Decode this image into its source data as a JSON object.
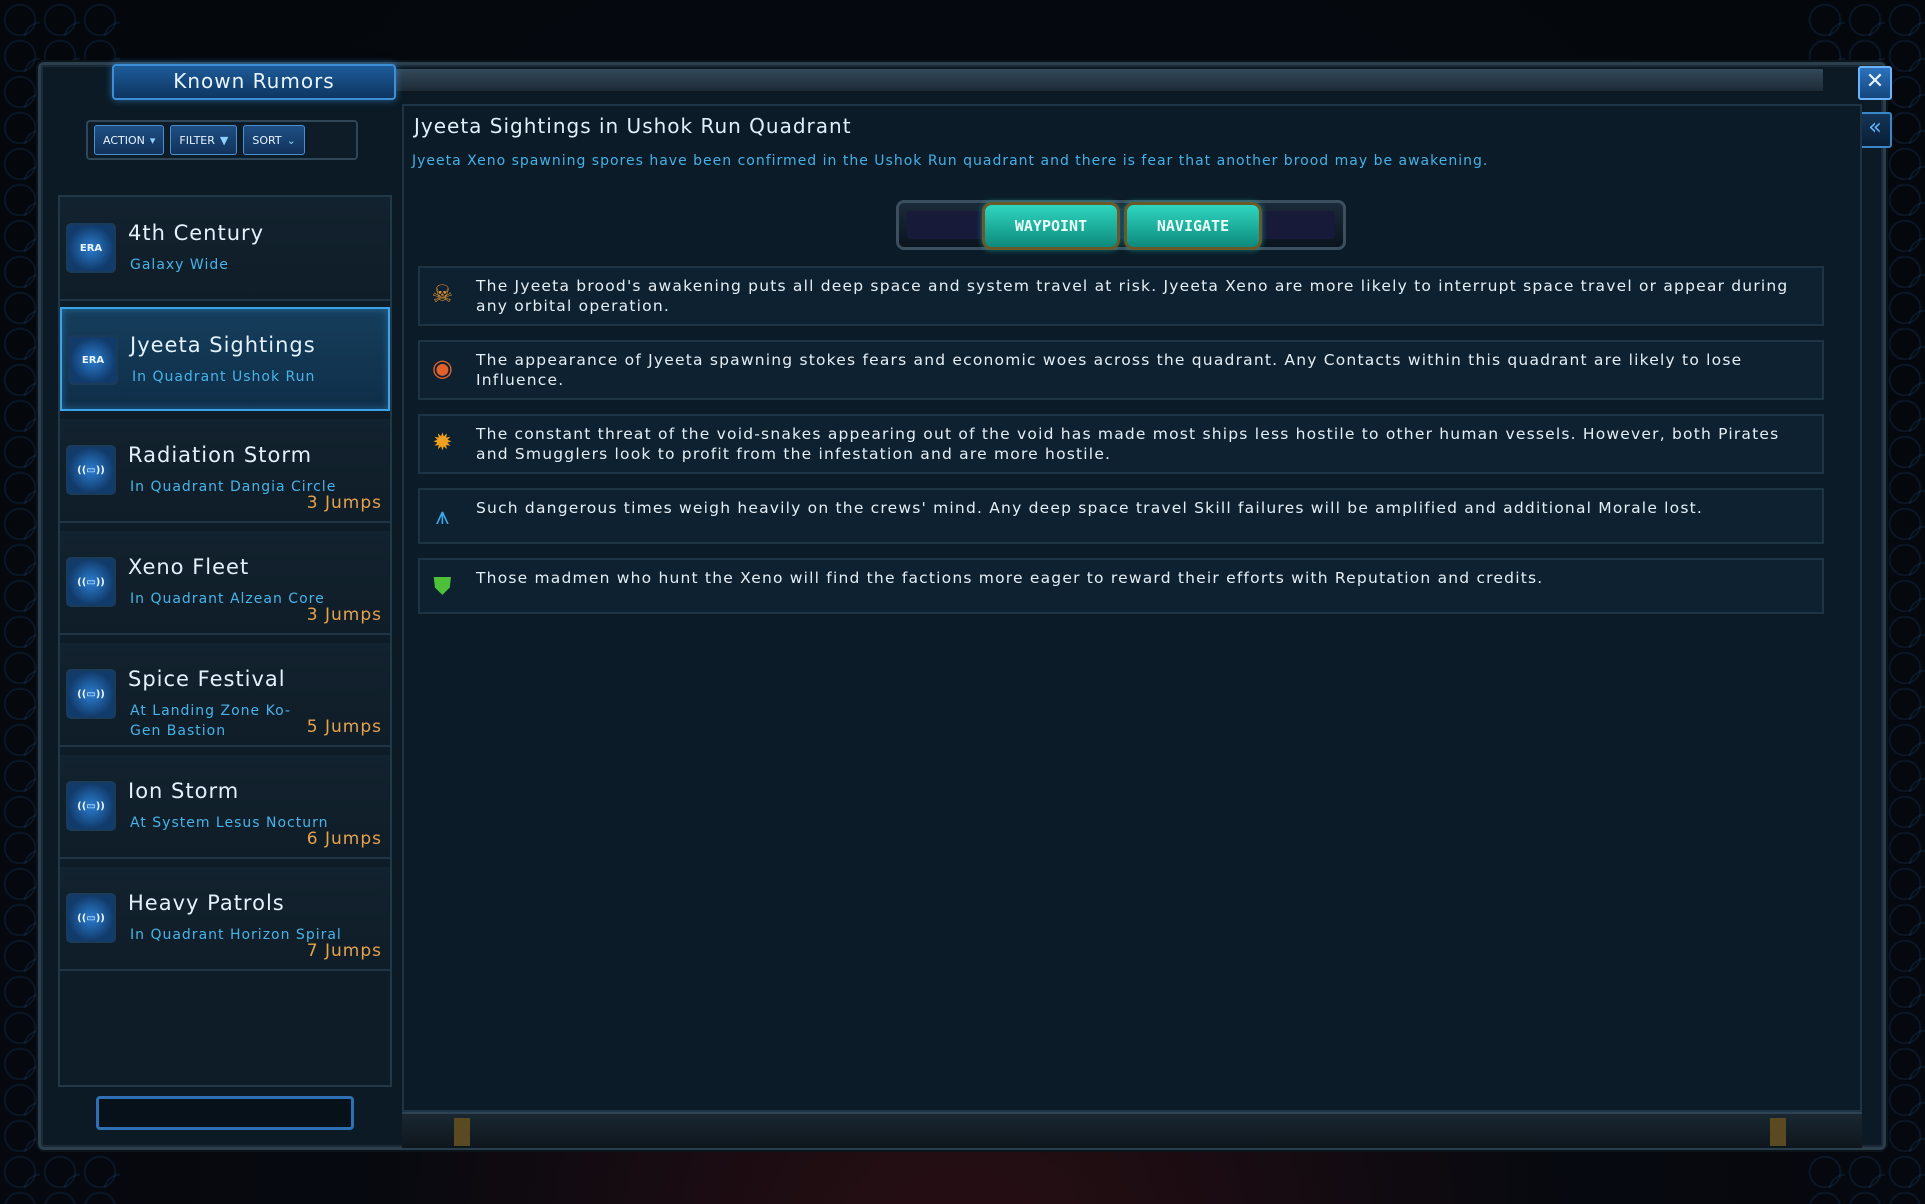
{
  "window": {
    "title": "Known Rumors"
  },
  "toolbar": {
    "action_label": "ACTION",
    "filter_label": "FILTER",
    "sort_label": "SORT"
  },
  "icons": {
    "close": "close-icon",
    "collapse": "double-chevron-left-icon"
  },
  "rumors": [
    {
      "name": "4th Century",
      "location": "Galaxy Wide",
      "jumps": "",
      "icon": "ERA"
    },
    {
      "name": "Jyeeta Sightings",
      "location": "In Quadrant Ushok Run",
      "jumps": "",
      "icon": "ERA",
      "selected": true
    },
    {
      "name": "Radiation Storm",
      "location": "In Quadrant Dangia Circle",
      "jumps": "3 Jumps",
      "icon": "rumor"
    },
    {
      "name": "Xeno Fleet",
      "location": "In Quadrant Alzean Core",
      "jumps": "3 Jumps",
      "icon": "rumor"
    },
    {
      "name": "Spice Festival",
      "location": "At Landing Zone Ko-Gen Bastion",
      "jumps": "5 Jumps",
      "icon": "rumor"
    },
    {
      "name": "Ion Storm",
      "location": "At System Lesus Nocturn",
      "jumps": "6 Jumps",
      "icon": "rumor"
    },
    {
      "name": "Heavy Patrols",
      "location": "In Quadrant Horizon Spiral",
      "jumps": "7 Jumps",
      "icon": "rumor"
    }
  ],
  "detail": {
    "title": "Jyeeta Sightings in Ushok Run Quadrant",
    "description": "Jyeeta Xeno spawning spores have been confirmed in the Ushok Run quadrant and there is fear that another brood may be awakening.",
    "waypoint_label": "WAYPOINT",
    "navigate_label": "NAVIGATE",
    "effects": [
      {
        "icon": "skull-icon",
        "color": "#e8952e",
        "text": "The Jyeeta brood's awakening puts all deep space and system travel at risk. Jyeeta Xeno are more likely to interrupt space travel or appear during any orbital operation."
      },
      {
        "icon": "influence-icon",
        "color": "#e0622a",
        "text": "The appearance of Jyeeta spawning stokes fears and economic woes across the quadrant. Any Contacts within this quadrant are likely to lose Influence."
      },
      {
        "icon": "explosion-icon",
        "color": "#f0a020",
        "text": "The constant threat of the void-snakes appearing out of the void has made most ships less hostile to other human vessels. However, both Pirates and Smugglers look to profit from the infestation and are more hostile."
      },
      {
        "icon": "morale-icon",
        "color": "#3aa8e8",
        "text": "Such dangerous times weigh heavily on the crews' mind. Any deep space travel Skill failures will be amplified and additional Morale lost."
      },
      {
        "icon": "reputation-icon",
        "color": "#4cc038",
        "text": "Those madmen who hunt the Xeno will find the factions more eager to reward their efforts with Reputation and credits."
      }
    ]
  }
}
